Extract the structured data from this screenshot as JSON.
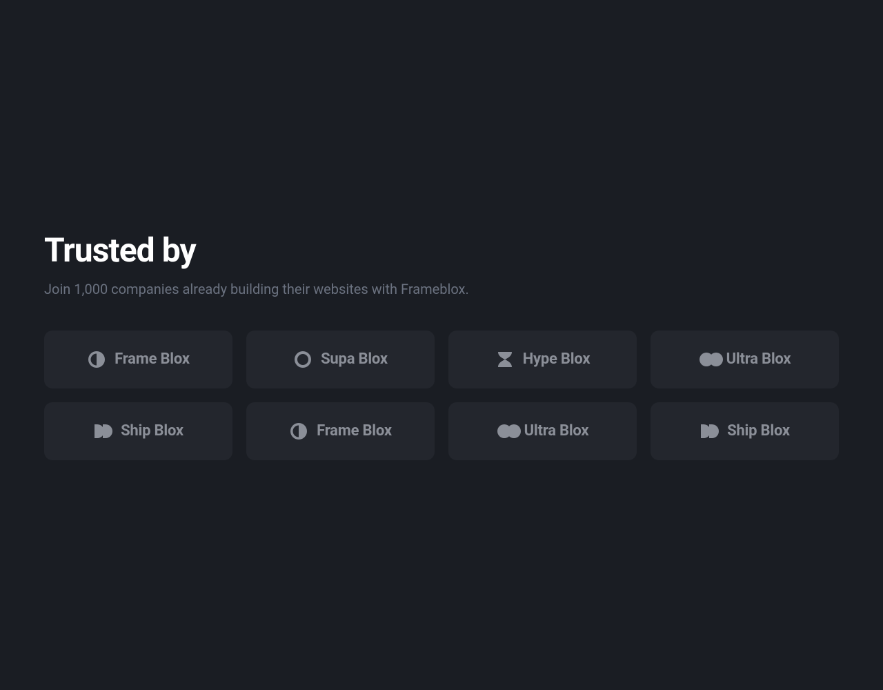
{
  "section": {
    "heading": "Trusted by",
    "subheading": "Join 1,000 companies already building their websites with Frameblox."
  },
  "companies": [
    {
      "name": "Frame Blox",
      "icon": "half-circle"
    },
    {
      "name": "Supa Blox",
      "icon": "ring"
    },
    {
      "name": "Hype Blox",
      "icon": "hourglass"
    },
    {
      "name": "Ultra Blox",
      "icon": "overlap-circles"
    },
    {
      "name": "Ship Blox",
      "icon": "double-d"
    },
    {
      "name": "Frame Blox",
      "icon": "half-circle"
    },
    {
      "name": "Ultra Blox",
      "icon": "overlap-circles"
    },
    {
      "name": "Ship Blox",
      "icon": "double-d"
    }
  ]
}
